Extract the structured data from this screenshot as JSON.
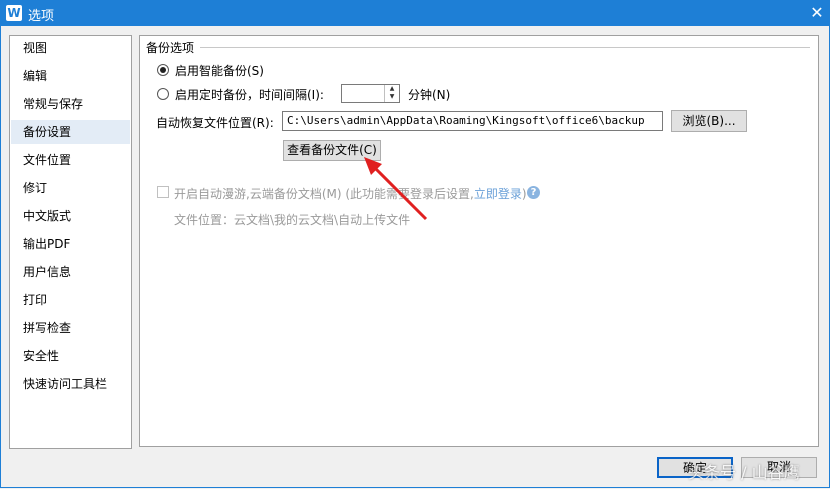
{
  "window": {
    "title": "选项",
    "app_icon_letter": "W",
    "close_symbol": "✕"
  },
  "sidebar": {
    "items": [
      {
        "label": "视图"
      },
      {
        "label": "编辑"
      },
      {
        "label": "常规与保存"
      },
      {
        "label": "备份设置"
      },
      {
        "label": "文件位置"
      },
      {
        "label": "修订"
      },
      {
        "label": "中文版式"
      },
      {
        "label": "输出PDF"
      },
      {
        "label": "用户信息"
      },
      {
        "label": "打印"
      },
      {
        "label": "拼写检查"
      },
      {
        "label": "安全性"
      },
      {
        "label": "快速访问工具栏"
      }
    ],
    "selected_index": 3
  },
  "backup": {
    "group_title": "备份选项",
    "smart_backup_label": "启用智能备份(S)",
    "smart_backup_selected": true,
    "timed_backup_label": "启用定时备份，时间间隔(I):",
    "timed_backup_selected": false,
    "interval_value": "",
    "minutes_label": "分钟(N)",
    "recover_path_label": "自动恢复文件位置(R):",
    "recover_path_value": "C:\\Users\\admin\\AppData\\Roaming\\Kingsoft\\office6\\backup",
    "browse_label": "浏览(B)...",
    "view_backup_label": "查看备份文件(C)",
    "cloud_label": "开启自动漫游,云端备份文档(M) (此功能需要登录后设置,",
    "cloud_link": "立即登录",
    "cloud_link_suffix": ")",
    "cloud_checked": false,
    "file_location_text": "文件位置：云文档\\我的云文档\\自动上传文件"
  },
  "footer": {
    "ok_label": "确定",
    "cancel_label": "取消"
  },
  "watermark": "头条号 / 山谷鹰",
  "colors": {
    "title_bar": "#1e7fd6",
    "annotation_arrow": "#e02020"
  }
}
